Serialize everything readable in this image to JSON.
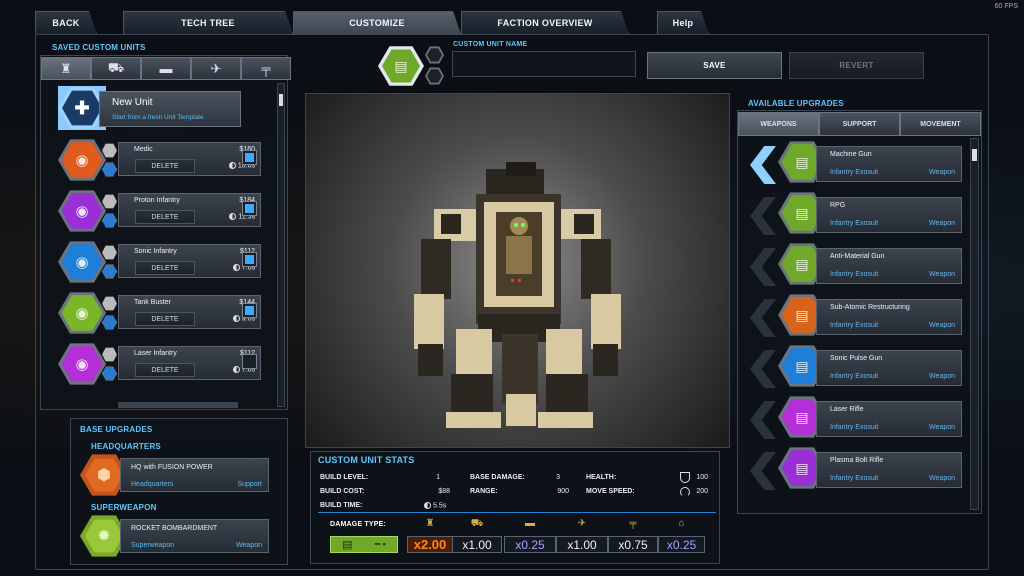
{
  "fps": "60 FPS",
  "nav": {
    "back": "BACK",
    "tabs": [
      "TECH TREE",
      "CUSTOMIZE",
      "FACTION OVERVIEW"
    ],
    "active_tab": "CUSTOMIZE",
    "help": "Help"
  },
  "saved_units": {
    "title": "SAVED CUSTOM UNITS",
    "category_icons": [
      "infantry-icon",
      "jeep-icon",
      "tank-icon",
      "aircraft-icon",
      "artillery-icon"
    ],
    "new_unit": {
      "name": "New Unit",
      "subtitle": "Start from a fresh Unit Template"
    },
    "delete_label": "DELETE",
    "units": [
      {
        "name": "Medic",
        "cost": "$160",
        "time": "10.0s",
        "color": "#e05a1c",
        "checked": true
      },
      {
        "name": "Proton Infantry",
        "cost": "$184",
        "time": "11.5s",
        "color": "#9b2fd6",
        "checked": true
      },
      {
        "name": "Sonic Infantry",
        "cost": "$112",
        "time": "7.0s",
        "color": "#1f7ed8",
        "checked": true
      },
      {
        "name": "Tank Buster",
        "cost": "$144",
        "time": "9.0s",
        "color": "#7bb52a",
        "checked": true
      },
      {
        "name": "Laser Infantry",
        "cost": "$112",
        "time": "7.0s",
        "color": "#b52fd6",
        "checked": false
      }
    ]
  },
  "base_upgrades": {
    "title": "BASE UPGRADES",
    "hq_title": "HEADQUARTERS",
    "hq": {
      "name": "HQ with FUSION POWER",
      "category": "Headquarters",
      "type": "Support"
    },
    "super_title": "SUPERWEAPON",
    "super": {
      "name": "ROCKET BOMBARDMENT",
      "category": "Superweapon",
      "type": "Weapon"
    }
  },
  "custom_name": {
    "label": "CUSTOM UNIT NAME",
    "value": "",
    "save": "SAVE",
    "revert": "REVERT"
  },
  "upgrades": {
    "title": "AVAILABLE UPGRADES",
    "tabs": [
      "WEAPONS",
      "SUPPORT",
      "MOVEMENT"
    ],
    "active_tab": "WEAPONS",
    "items": [
      {
        "name": "Machine Gun",
        "category": "Infantry Exosuit",
        "type": "Weapon",
        "color": "#6fa82a",
        "active": true
      },
      {
        "name": "RPG",
        "category": "Infantry Exosuit",
        "type": "Weapon",
        "color": "#6fa82a",
        "active": false
      },
      {
        "name": "Anti-Material Gun",
        "category": "Infantry Exosuit",
        "type": "Weapon",
        "color": "#6fa82a",
        "active": false
      },
      {
        "name": "Sub-Atomic Restructuring",
        "category": "Infantry Exosuit",
        "type": "Weapon",
        "color": "#d8641c",
        "active": false
      },
      {
        "name": "Sonic Pulse Gun",
        "category": "Infantry Exosuit",
        "type": "Weapon",
        "color": "#1f7ed8",
        "active": false
      },
      {
        "name": "Laser Rifle",
        "category": "Infantry Exosuit",
        "type": "Weapon",
        "color": "#b52fd6",
        "active": false
      },
      {
        "name": "Plasma Bolt Rifle",
        "category": "Infantry Exosuit",
        "type": "Weapon",
        "color": "#9b2fd6",
        "active": false
      }
    ]
  },
  "stats": {
    "title": "CUSTOM UNIT STATS",
    "build_level_lbl": "BUILD LEVEL:",
    "build_level": "1",
    "base_damage_lbl": "BASE DAMAGE:",
    "base_damage": "3",
    "health_lbl": "HEALTH:",
    "health": "100",
    "build_cost_lbl": "BUILD COST:",
    "build_cost": "$88",
    "range_lbl": "RANGE:",
    "range": "900",
    "move_speed_lbl": "MOVE SPEED:",
    "move_speed": "200",
    "build_time_lbl": "BUILD TIME:",
    "build_time": "5.5s",
    "damage_type_lbl": "DAMAGE TYPE:",
    "damage_icons": [
      "infantry-icon",
      "jeep-icon",
      "tank-icon",
      "aircraft-icon",
      "artillery-icon",
      "structure-icon"
    ],
    "multipliers": [
      {
        "value": "x2.00",
        "color": "#ff8a1c",
        "highlight": true
      },
      {
        "value": "x1.00",
        "color": "#f0f4f8",
        "highlight": false
      },
      {
        "value": "x0.25",
        "color": "#a9a0ff",
        "highlight": false
      },
      {
        "value": "x1.00",
        "color": "#f0f4f8",
        "highlight": false
      },
      {
        "value": "x0.75",
        "color": "#f0f4f8",
        "highlight": false
      },
      {
        "value": "x0.25",
        "color": "#a9a0ff",
        "highlight": false
      }
    ]
  }
}
